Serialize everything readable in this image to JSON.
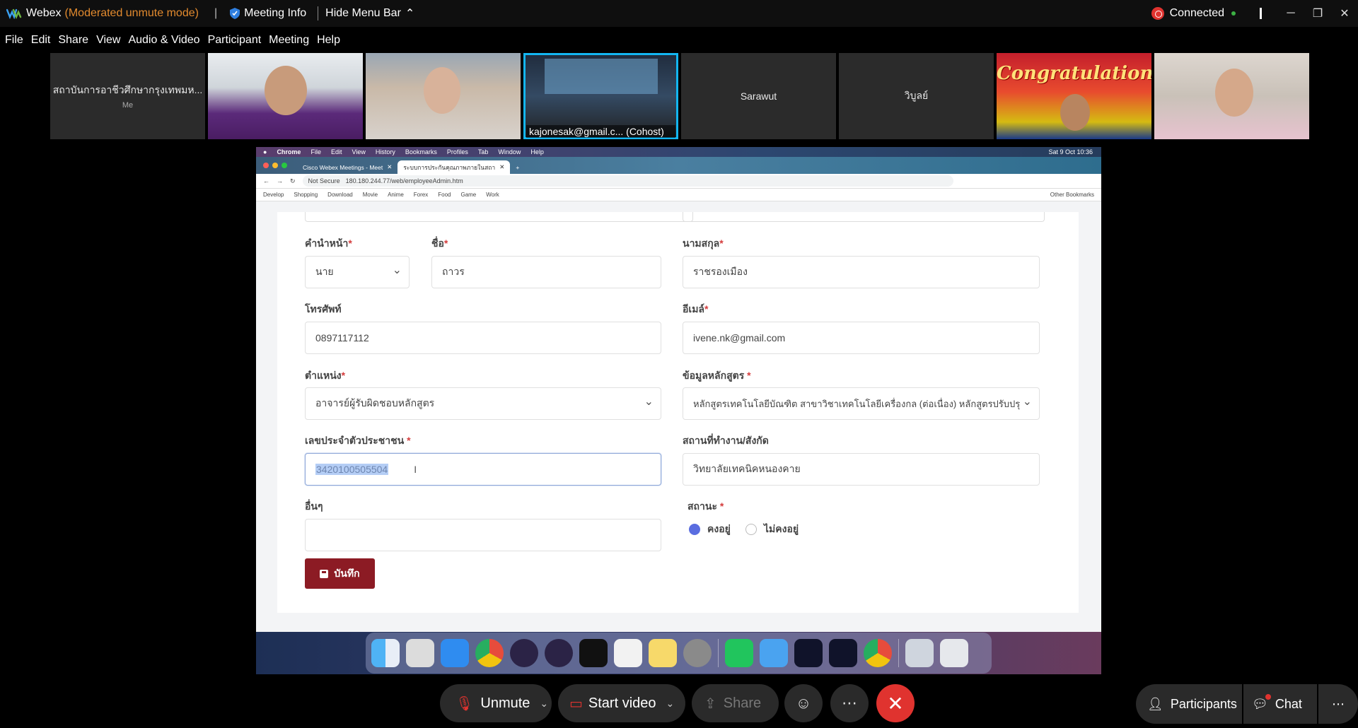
{
  "window": {
    "app_name": "Webex",
    "mode": "(Moderated unmute mode)",
    "meeting_info": "Meeting Info",
    "hide_menu": "Hide Menu Bar",
    "status": "Connected"
  },
  "menu": [
    "File",
    "Edit",
    "Share",
    "View",
    "Audio & Video",
    "Participant",
    "Meeting",
    "Help"
  ],
  "participants": [
    {
      "name": "สถาบันการอาชีวศึกษากรุงเทพมห...",
      "sub": "Me"
    },
    {
      "name": ""
    },
    {
      "name": ""
    },
    {
      "name": "kajonesak@gmail.c...   (Cohost)"
    },
    {
      "name": "Sarawut"
    },
    {
      "name": "วิบูลย์"
    },
    {
      "name": "",
      "overlay": "Congratulations"
    },
    {
      "name": ""
    }
  ],
  "browser": {
    "mac_menu": [
      "Chrome",
      "File",
      "Edit",
      "View",
      "History",
      "Bookmarks",
      "Profiles",
      "Tab",
      "Window",
      "Help"
    ],
    "clock": "Sat 9 Oct  10:36",
    "tabs": [
      "Cisco Webex Meetings - Meet",
      "ระบบการประกันคุณภาพภายในสถา"
    ],
    "not_secure": "Not Secure",
    "url": "180.180.244.77/web/employeeAdmin.htm",
    "bookmarks": [
      "Develop",
      "Shopping",
      "Download",
      "Movie",
      "Anime",
      "Forex",
      "Food",
      "Game",
      "Work"
    ],
    "other_bookmarks": "Other Bookmarks"
  },
  "form": {
    "title_label": "คำนำหน้า",
    "title_value": "นาย",
    "firstname_label": "ชื่อ",
    "firstname_value": "ถาวร",
    "lastname_label": "นามสกุล",
    "lastname_value": "ราชรองเมือง",
    "phone_label": "โทรศัพท์",
    "phone_value": "0897117112",
    "email_label": "อีเมล์",
    "email_value": "ivene.nk@gmail.com",
    "position_label": "ตำแหน่ง",
    "position_value": "อาจารย์ผู้รับผิดชอบหลักสูตร",
    "course_label": "ข้อมูลหลักสูตร",
    "course_value": "หลักสูตรเทคโนโลยีบัณฑิต สาขาวิชาเทคโนโลยีเครื่องกล (ต่อเนื่อง) หลักสูตรปรับปรุ",
    "idcard_label": "เลขประจำตัวประชาชน",
    "idcard_value": "3420100505504",
    "workplace_label": "สถานที่ทำงาน/สังกัด",
    "workplace_value": "วิทยาลัยเทคนิคหนองคาย",
    "other_label": "อื่นๆ",
    "other_value": "",
    "status_label": "สถานะ",
    "status_options": [
      "คงอยู่",
      "ไม่คงอยู่"
    ],
    "save_label": "บันทึก",
    "required_mark": "*"
  },
  "controls": {
    "unmute": "Unmute",
    "start_video": "Start video",
    "share": "Share",
    "participants": "Participants",
    "chat": "Chat"
  },
  "colors": {
    "accent_blue": "#13b6f2",
    "end_red": "#e0332f",
    "save_button": "#8c1b24",
    "mode_orange": "#e28a2e"
  }
}
